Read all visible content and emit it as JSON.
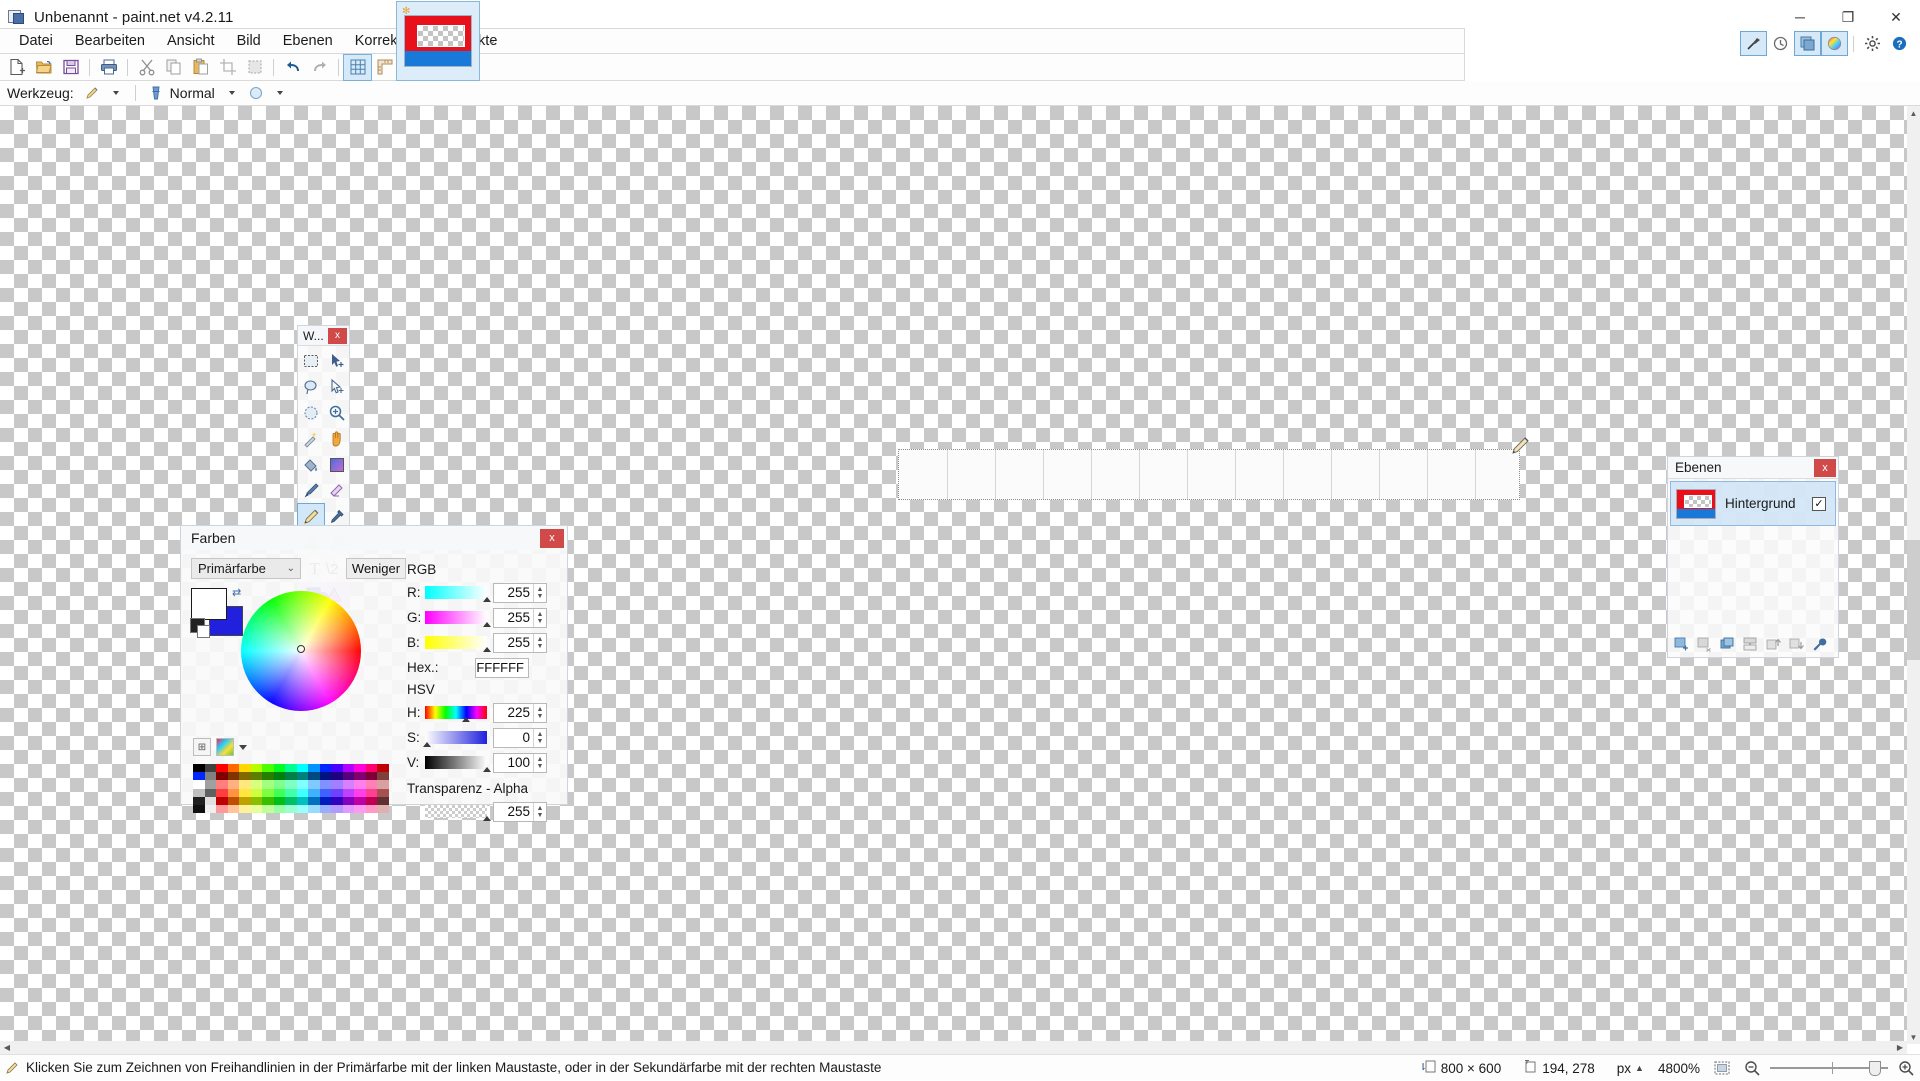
{
  "window": {
    "title": "Unbenannt - paint.net v4.2.11",
    "app_icon": "paintnet-icon",
    "minimize": "─",
    "maximize": "❐",
    "close": "✕"
  },
  "menubar": {
    "items": [
      {
        "label": "Datei",
        "name": "menu-datei"
      },
      {
        "label": "Bearbeiten",
        "name": "menu-bearbeiten"
      },
      {
        "label": "Ansicht",
        "name": "menu-ansicht"
      },
      {
        "label": "Bild",
        "name": "menu-bild"
      },
      {
        "label": "Ebenen",
        "name": "menu-ebenen"
      },
      {
        "label": "Korrekturen",
        "name": "menu-korrekturen"
      },
      {
        "label": "Effekte",
        "name": "menu-effekte"
      }
    ]
  },
  "toolbar": {
    "buttons": [
      {
        "name": "new-file-button",
        "icon": "new-document-icon"
      },
      {
        "name": "open-file-button",
        "icon": "open-folder-icon"
      },
      {
        "name": "save-file-button",
        "icon": "save-disk-icon"
      },
      {
        "name": "print-button",
        "icon": "printer-icon"
      },
      {
        "name": "cut-button",
        "icon": "scissors-icon"
      },
      {
        "name": "copy-button",
        "icon": "copy-icon"
      },
      {
        "name": "paste-button",
        "icon": "paste-icon"
      },
      {
        "name": "crop-button",
        "icon": "crop-icon"
      },
      {
        "name": "deselect-button",
        "icon": "deselect-icon"
      },
      {
        "name": "undo-button",
        "icon": "undo-arrow-icon"
      },
      {
        "name": "redo-button",
        "icon": "redo-arrow-icon"
      },
      {
        "name": "pixel-grid-button",
        "icon": "grid-icon",
        "active": true
      },
      {
        "name": "rulers-button",
        "icon": "ruler-icon"
      }
    ]
  },
  "options_bar": {
    "tool_label": "Werkzeug:",
    "tool_icon": "pencil-icon",
    "blend_label": "Normal",
    "blend_icon": "blend-mode-icon",
    "antialias_icon": "antialiasing-icon"
  },
  "document_tab": {
    "name": "Unbenannt",
    "thumbnail": "document-thumbnail"
  },
  "panel_toggles": [
    {
      "name": "tools-panel-toggle",
      "icon": "hammer-icon",
      "active": true
    },
    {
      "name": "history-panel-toggle",
      "icon": "clock-history-icon",
      "active": false
    },
    {
      "name": "layers-panel-toggle",
      "icon": "layers-stack-icon",
      "active": true
    },
    {
      "name": "colors-panel-toggle",
      "icon": "color-wheel-icon",
      "active": true
    },
    {
      "name": "settings-button",
      "icon": "gear-icon",
      "active": false
    },
    {
      "name": "help-button",
      "icon": "question-help-icon",
      "active": false
    }
  ],
  "tools_window": {
    "title": "W...",
    "close": "x",
    "tools": [
      {
        "name": "tool-rectangle-select",
        "icon": "rectangle-select-icon"
      },
      {
        "name": "tool-move-selected",
        "icon": "move-selection-icon"
      },
      {
        "name": "tool-lasso-select",
        "icon": "lasso-select-icon"
      },
      {
        "name": "tool-move-selection",
        "icon": "move-selection-outline-icon"
      },
      {
        "name": "tool-ellipse-select",
        "icon": "ellipse-select-icon"
      },
      {
        "name": "tool-zoom",
        "icon": "magnifier-icon"
      },
      {
        "name": "tool-magic-wand",
        "icon": "magic-wand-icon"
      },
      {
        "name": "tool-pan",
        "icon": "hand-pan-icon"
      },
      {
        "name": "tool-paint-bucket",
        "icon": "paint-bucket-icon"
      },
      {
        "name": "tool-gradient",
        "icon": "gradient-icon"
      },
      {
        "name": "tool-paintbrush",
        "icon": "paintbrush-icon"
      },
      {
        "name": "tool-eraser",
        "icon": "eraser-icon"
      },
      {
        "name": "tool-pencil",
        "icon": "pencil-icon",
        "selected": true
      },
      {
        "name": "tool-color-picker",
        "icon": "eyedropper-icon"
      },
      {
        "name": "tool-clone-stamp",
        "icon": "clone-stamp-icon"
      },
      {
        "name": "tool-recolor",
        "icon": "recolor-icon"
      }
    ],
    "text_tool": {
      "name": "tool-text",
      "icon": "text-T-icon"
    },
    "line_tool": {
      "name": "tool-line-curve",
      "icon": "line-curve-icon"
    },
    "shapes_tool": {
      "name": "tool-shapes",
      "icon": "shapes-icon"
    }
  },
  "colors_window": {
    "title": "Farben",
    "close": "x",
    "mode_select": "Primärfarbe",
    "less_button": "Weniger",
    "primary_color": "#FFFFFF",
    "secondary_color": "#2020DD",
    "rgb_label": "RGB",
    "hsv_label": "HSV",
    "alpha_label": "Transparenz - Alpha",
    "fields": {
      "r_label": "R:",
      "r_value": "255",
      "g_label": "G:",
      "g_value": "255",
      "b_label": "B:",
      "b_value": "255",
      "hex_label": "Hex.:",
      "hex_value": "FFFFFF",
      "h_label": "H:",
      "h_value": "225",
      "s_label": "S:",
      "s_value": "0",
      "v_label": "V:",
      "v_value": "100",
      "alpha_value": "255"
    },
    "palette_add_icon": "add-swatch-icon",
    "palette_menu_icon": "palette-icon"
  },
  "layers_window": {
    "title": "Ebenen",
    "close": "x",
    "layers": [
      {
        "name": "Hintergrund",
        "visible": true,
        "checkmark": "✓"
      }
    ],
    "buttons": [
      {
        "name": "add-layer-button",
        "icon": "add-layer-icon"
      },
      {
        "name": "delete-layer-button",
        "icon": "delete-layer-icon"
      },
      {
        "name": "duplicate-layer-button",
        "icon": "duplicate-layer-icon"
      },
      {
        "name": "merge-layer-down-button",
        "icon": "merge-down-icon"
      },
      {
        "name": "move-layer-up-button",
        "icon": "move-layer-up-icon"
      },
      {
        "name": "move-layer-down-button",
        "icon": "move-layer-down-icon"
      },
      {
        "name": "layer-properties-button",
        "icon": "wrench-icon"
      }
    ]
  },
  "statusbar": {
    "cursor_icon": "pencil-icon",
    "message": "Klicken Sie zum Zeichnen von Freihandlinien in der Primärfarbe mit der linken Maustaste, oder in der Sekundärfarbe mit der rechten Maustaste",
    "image_size_icon": "image-size-icon",
    "image_size": "800 × 600",
    "cursor_pos_icon": "cursor-position-icon",
    "cursor_position": "194, 278",
    "unit": "px",
    "zoom_level": "4800%",
    "fit_icon": "fit-to-window-icon",
    "zoom_out_icon": "zoom-out-icon",
    "zoom_in_icon": "zoom-in-icon"
  },
  "canvas": {
    "zoom": "4800%",
    "pixel_grid": true,
    "stroke_color": "#FBFBFB"
  }
}
